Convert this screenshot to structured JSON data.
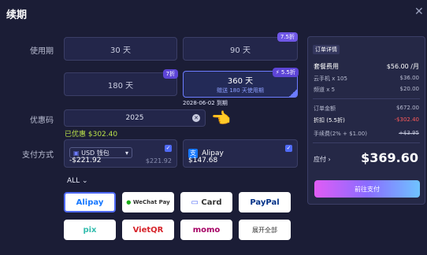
{
  "header": {
    "title": "续期"
  },
  "labels": {
    "period": "使用期",
    "coupon": "优惠码",
    "payment": "支付方式"
  },
  "plans": [
    {
      "label": "30 天"
    },
    {
      "label": "90 天",
      "badge": "7.5折"
    },
    {
      "label": "180 天",
      "badge": "7折"
    },
    {
      "label": "360 天",
      "badge": "5.5折",
      "sub": "赠送 180 天使用期"
    }
  ],
  "expiry": "2028-06-02 到期",
  "coupon": {
    "code": "2025",
    "saved": "已优惠 $302.40"
  },
  "pay": {
    "usd": {
      "currency": "USD 钱包",
      "amount": "-$221.92",
      "original": "$221.92"
    },
    "alipay": {
      "name": "Alipay",
      "amount": "$147.68"
    }
  },
  "all_label": "ALL",
  "methods": [
    "Alipay",
    "WeChat Pay",
    "Card",
    "PayPal",
    "pix",
    "VietQR",
    "momo",
    "展开全部"
  ],
  "order": {
    "title": "订单详情",
    "rows": [
      {
        "k": "套餐费用",
        "v": "$56.00 /月"
      },
      {
        "k": "云手机 x 105",
        "v": "$36.00"
      },
      {
        "k": "频道 x 5",
        "v": "$20.00"
      }
    ],
    "rows2": [
      {
        "k": "订单金额",
        "v": "$672.00"
      },
      {
        "k": "折扣 (5.5折)",
        "v": "-$302.40"
      },
      {
        "k": "手续费(2% + $1.00)",
        "v": "+$3.95"
      }
    ],
    "total_label": "应付",
    "total": "$369.60",
    "button": "前往支付"
  },
  "colors": {
    "accent": "#6c7cff",
    "discount": "#ff5a5a",
    "saved": "#b9e04a"
  }
}
